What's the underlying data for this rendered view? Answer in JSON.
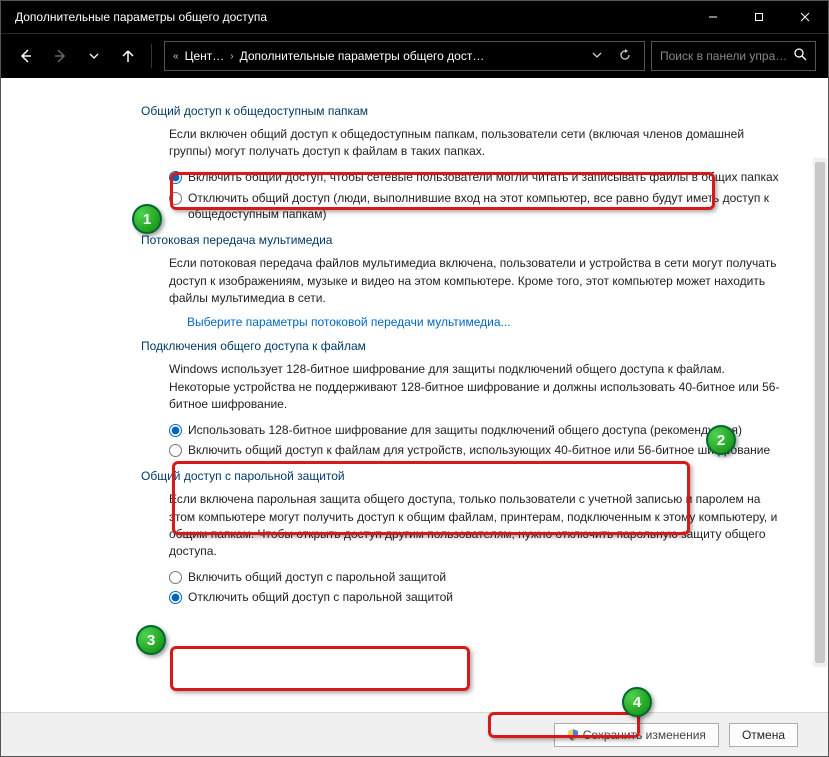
{
  "titlebar": {
    "title": "Дополнительные параметры общего доступа"
  },
  "breadcrumb": {
    "seg1": "Цент…",
    "seg2": "Дополнительные параметры общего дост…"
  },
  "search": {
    "placeholder": "Поиск в панели упра…"
  },
  "sections": {
    "public": {
      "title": "Общий доступ к общедоступным папкам",
      "desc": "Если включен общий доступ к общедоступным папкам, пользователи сети (включая членов домашней группы) могут получать доступ к файлам в таких папках.",
      "opt1": "Включить общий доступ, чтобы сетевые пользователи могли читать и записывать файлы в общих папках",
      "opt2": "Отключить общий доступ (люди, выполнившие вход на этот компьютер, все равно будут иметь доступ к общедоступным папкам)"
    },
    "media": {
      "title": "Потоковая передача мультимедиа",
      "desc": "Если потоковая передача файлов мультимедиа включена, пользователи и устройства в сети могут получать доступ к изображениям, музыке и видео на этом компьютере. Кроме того, этот компьютер может находить файлы мультимедиа в сети.",
      "link": "Выберите параметры потоковой передачи мультимедиа..."
    },
    "filesharing": {
      "title": "Подключения общего доступа к файлам",
      "desc": "Windows использует 128-битное шифрование для защиты подключений общего доступа к файлам. Некоторые устройства не поддерживают 128-битное шифрование и должны использовать 40-битное или 56-битное шифрование.",
      "opt1": "Использовать 128-битное шифрование для защиты подключений общего доступа (рекомендуется)",
      "opt2": "Включить общий доступ к файлам для устройств, использующих 40-битное или 56-битное шифрование"
    },
    "password": {
      "title": "Общий доступ с парольной защитой",
      "desc": "Если включена парольная защита общего доступа, только пользователи с учетной записью и паролем на этом компьютере могут получить доступ к общим файлам, принтерам, подключенным к этому компьютеру, и общим папкам. Чтобы открыть доступ другим пользователям, нужно отключить парольную защиту общего доступа.",
      "opt1": "Включить общий доступ с парольной защитой",
      "opt2": "Отключить общий доступ с парольной защитой"
    }
  },
  "footer": {
    "save": "Сохранить изменения",
    "cancel": "Отмена"
  },
  "badges": {
    "b1": "1",
    "b2": "2",
    "b3": "3",
    "b4": "4"
  }
}
